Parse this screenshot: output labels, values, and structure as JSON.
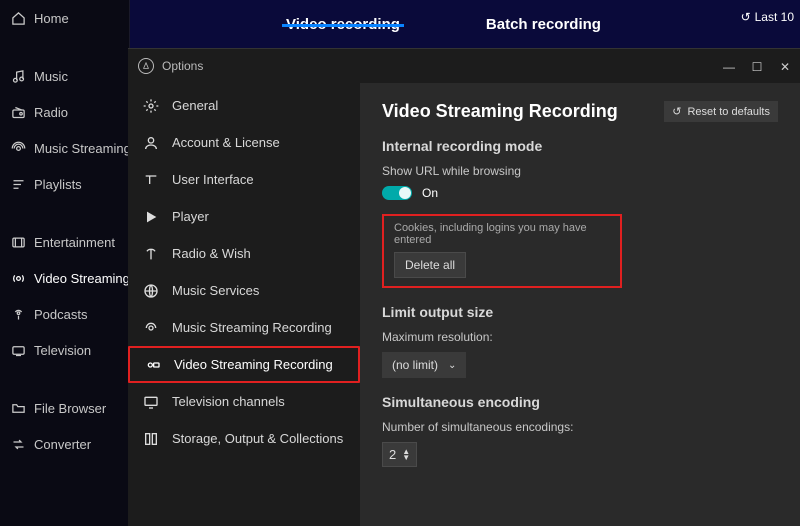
{
  "topTabs": {
    "video": "Video recording",
    "batch": "Batch recording",
    "lastLabel": "Last 10"
  },
  "mainSidebar": {
    "home": "Home",
    "music": "Music",
    "radio": "Radio",
    "musicStreaming": "Music Streaming",
    "playlists": "Playlists",
    "entertainment": "Entertainment",
    "videoStreaming": "Video Streaming",
    "podcasts": "Podcasts",
    "television": "Television",
    "fileBrowser": "File Browser",
    "converter": "Converter"
  },
  "optionsWindow": {
    "title": "Options"
  },
  "optionsSidebar": {
    "general": "General",
    "account": "Account & License",
    "ui": "User Interface",
    "player": "Player",
    "radio": "Radio & Wish",
    "musicServices": "Music Services",
    "musicRec": "Music Streaming Recording",
    "videoRec": "Video Streaming Recording",
    "tvChannels": "Television channels",
    "storage": "Storage, Output & Collections"
  },
  "content": {
    "title": "Video Streaming Recording",
    "reset": "Reset to defaults",
    "section1": "Internal recording mode",
    "showUrlLabel": "Show URL while browsing",
    "onLabel": "On",
    "cookiesHint": "Cookies, including logins you may have entered",
    "deleteAll": "Delete all",
    "section2": "Limit output size",
    "maxResLabel": "Maximum resolution:",
    "maxResValue": "(no limit)",
    "section3": "Simultaneous encoding",
    "simEncLabel": "Number of simultaneous encodings:",
    "simEncValue": "2"
  }
}
